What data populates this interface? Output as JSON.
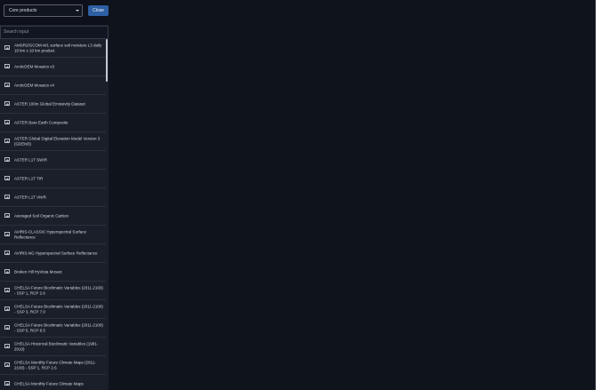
{
  "header": {
    "dropdown_value": "Core products",
    "close_label": "Close"
  },
  "search": {
    "placeholder": "Search input"
  },
  "list": {
    "items": [
      {
        "label": "AMSR2/GCOM-W1 surface soil moisture L3 daily 10 km x 10 km product",
        "icon": "image-icon"
      },
      {
        "label": "ArcticDEM Mosaics v3",
        "icon": "image-icon"
      },
      {
        "label": "ArcticDEM Mosaics v4",
        "icon": "image-icon"
      },
      {
        "label": "ASTER 100m Global Emissivity Dataset",
        "icon": "image-icon"
      },
      {
        "label": "ASTER Bare Earth Composite",
        "icon": "image-icon"
      },
      {
        "label": "ASTER Global Digital Elevation Model Version 3 (GDEM3)",
        "icon": "image-icon"
      },
      {
        "label": "ASTER L1T SWIR",
        "icon": "image-icon"
      },
      {
        "label": "ASTER L1T TIR",
        "icon": "image-icon"
      },
      {
        "label": "ASTER L1T VNIR",
        "icon": "image-icon"
      },
      {
        "label": "Averaged Soil Organic Carbon",
        "icon": "image-icon"
      },
      {
        "label": "AVIRIS-CLASSIC Hyperspectral Surface Reflectance",
        "icon": "image-icon"
      },
      {
        "label": "AVIRIS-NG Hyperspectral Surface Reflectance",
        "icon": "image-icon"
      },
      {
        "label": "Broken Hill HyVista Mosaic",
        "icon": "image-icon"
      },
      {
        "label": "CHELSA Future Bioclimatic Variables (2011-2100) - SSP 1, RCP 2.6",
        "icon": "image-icon"
      },
      {
        "label": "CHELSA Future Bioclimatic Variables (2011-2100) - SSP 3, RCP 7.0",
        "icon": "image-icon"
      },
      {
        "label": "CHELSA Future Bioclimatic Variables (2011-2100) - SSP 5, RCP 8.5",
        "icon": "image-icon"
      },
      {
        "label": "CHELSA Historical Bioclimatic Variables (1981-2010)",
        "icon": "image-icon"
      },
      {
        "label": "CHELSA Monthly Future Climate Maps (2011-2100) - SSP 1, RCP 2.6",
        "icon": "image-icon"
      },
      {
        "label": "CHELSA Monthly Future Climate Maps",
        "icon": "image-icon"
      }
    ]
  }
}
